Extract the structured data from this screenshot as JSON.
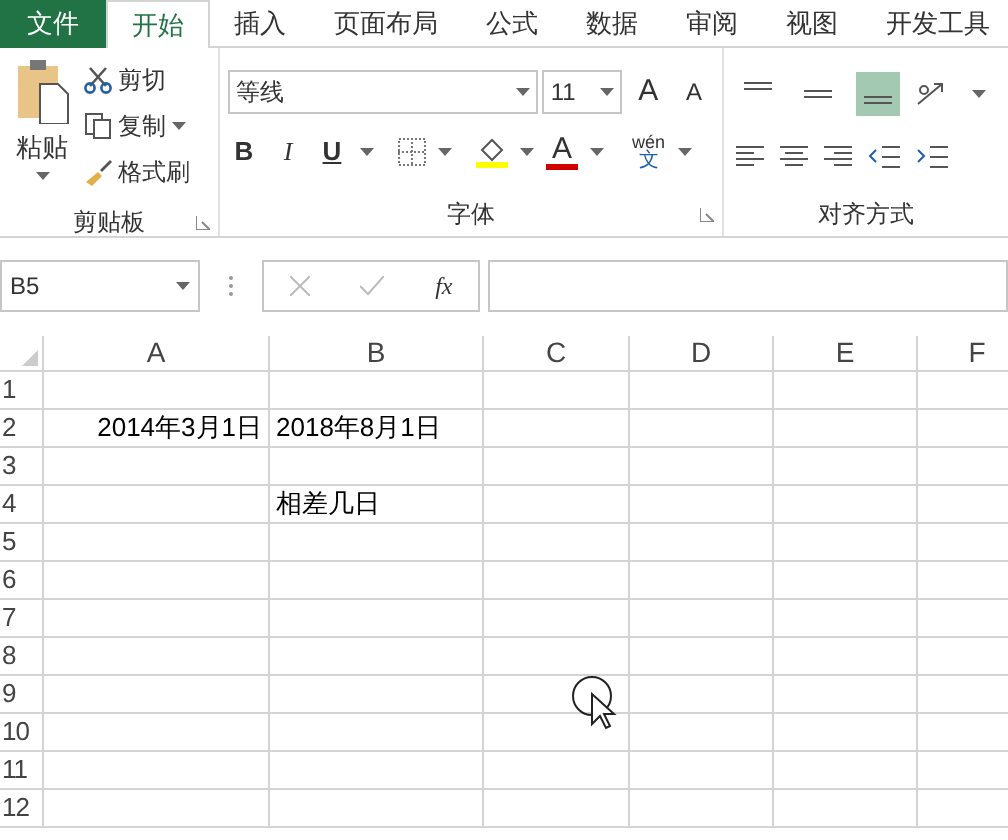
{
  "tabs": [
    {
      "label": "文件",
      "kind": "file",
      "selected": false
    },
    {
      "label": "开始",
      "kind": "tab",
      "selected": true
    },
    {
      "label": "插入",
      "kind": "tab",
      "selected": false
    },
    {
      "label": "页面布局",
      "kind": "tab",
      "selected": false
    },
    {
      "label": "公式",
      "kind": "tab",
      "selected": false
    },
    {
      "label": "数据",
      "kind": "tab",
      "selected": false
    },
    {
      "label": "审阅",
      "kind": "tab",
      "selected": false
    },
    {
      "label": "视图",
      "kind": "tab",
      "selected": false
    },
    {
      "label": "开发工具",
      "kind": "tab",
      "selected": false
    }
  ],
  "clipboard": {
    "paste": "粘贴",
    "cut": "剪切",
    "copy": "复制",
    "format_painter": "格式刷",
    "label": "剪贴板"
  },
  "font": {
    "name": "等线",
    "size": "11",
    "grow": "A",
    "shrink": "A",
    "bold": "B",
    "italic": "I",
    "underline": "U",
    "font_color": "A",
    "phonetic_top": "wén",
    "phonetic_bottom": "文",
    "label": "字体"
  },
  "alignment": {
    "label": "对齐方式",
    "vertical": [
      {
        "selected": false
      },
      {
        "selected": false
      },
      {
        "selected": true
      }
    ]
  },
  "formula_bar": {
    "name_box": "B5",
    "fx": "fx"
  },
  "columns": [
    "A",
    "B",
    "C",
    "D",
    "E",
    "F"
  ],
  "rows": [
    {
      "label": "1"
    },
    {
      "label": "2",
      "column_a": "2014年3月1日",
      "column_b": "2018年8月1日"
    },
    {
      "label": "3"
    },
    {
      "label": "4",
      "column_b": "相差几日"
    },
    {
      "label": "5"
    },
    {
      "label": "6"
    },
    {
      "label": "7"
    },
    {
      "label": "8"
    },
    {
      "label": "9"
    },
    {
      "label": "10"
    },
    {
      "label": "11"
    },
    {
      "label": "12"
    }
  ]
}
